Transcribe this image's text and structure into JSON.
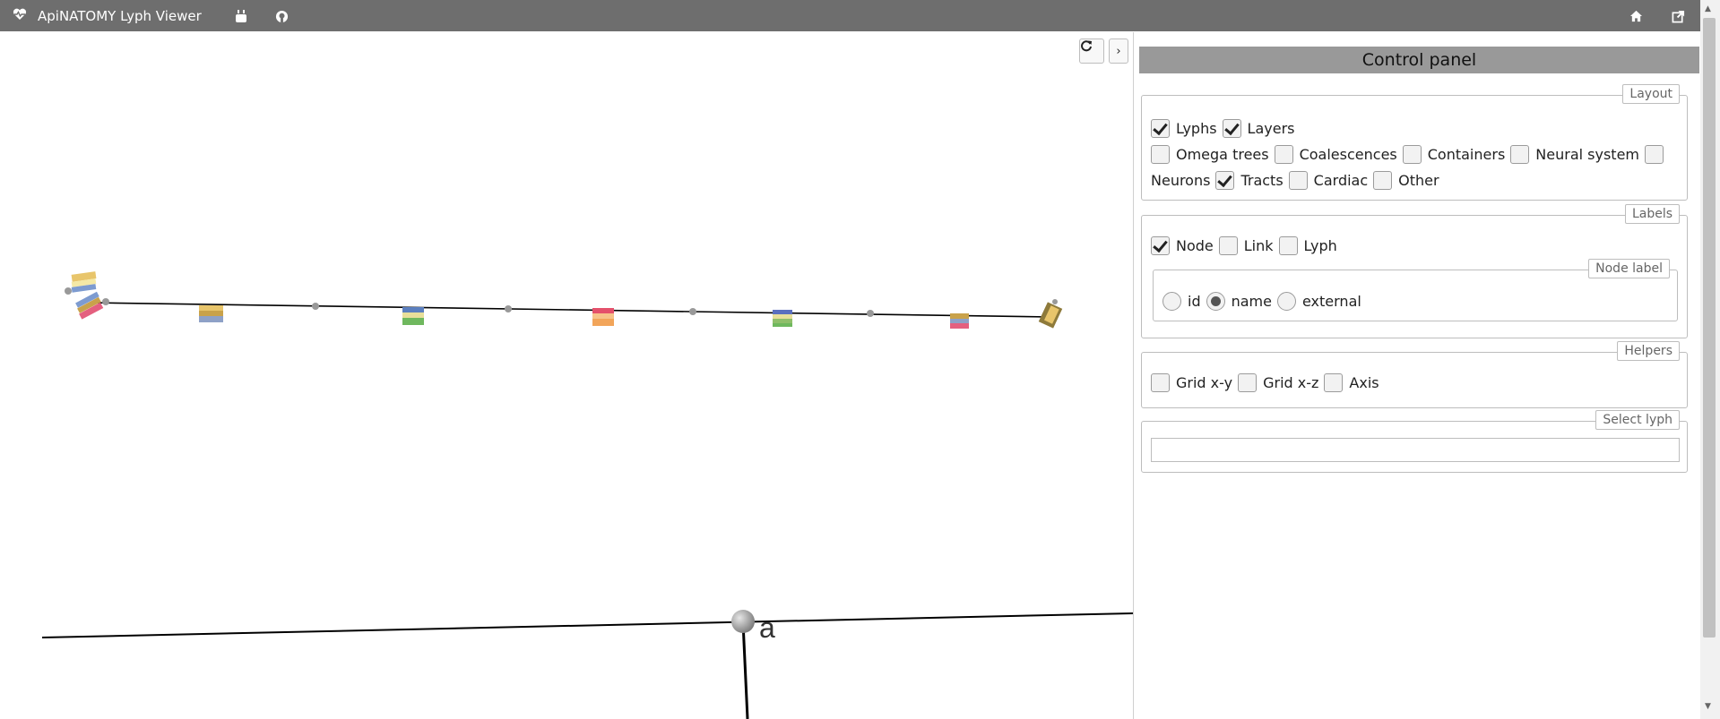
{
  "app": {
    "title": "ApiNATOMY Lyph Viewer",
    "icons": [
      "heart-logo-icon",
      "youtube-icon",
      "github-icon",
      "home-icon",
      "external-link-icon"
    ]
  },
  "sidetools": [
    "open-folder-icon",
    "edit-icon"
  ],
  "viewer": {
    "node_label": "a",
    "buttons": [
      "refresh-icon",
      "chevron-right-icon"
    ],
    "lyph_colors": [
      "#e8c56b",
      "#f2a55a",
      "#7d9bd0",
      "#6fb85e",
      "#e4607f",
      "#9a9a9a"
    ]
  },
  "panel": {
    "title": "Control panel",
    "layout": {
      "legend": "Layout",
      "items": [
        {
          "label": "Lyphs",
          "checked": true
        },
        {
          "label": "Layers",
          "checked": true
        },
        {
          "label": "Omega trees",
          "checked": false
        },
        {
          "label": "Coalescences",
          "checked": false
        },
        {
          "label": "Containers",
          "checked": false
        },
        {
          "label": "Neural system",
          "checked": false
        },
        {
          "label": "Neurons",
          "checked": false
        },
        {
          "label": "Tracts",
          "checked": true
        },
        {
          "label": "Cardiac",
          "checked": false
        },
        {
          "label": "Other",
          "checked": false
        }
      ]
    },
    "labels": {
      "legend": "Labels",
      "items": [
        {
          "label": "Node",
          "checked": true
        },
        {
          "label": "Link",
          "checked": false
        },
        {
          "label": "Lyph",
          "checked": false
        }
      ],
      "node_label": {
        "legend": "Node label",
        "options": [
          "id",
          "name",
          "external"
        ],
        "selected": "name"
      }
    },
    "helpers": {
      "legend": "Helpers",
      "items": [
        {
          "label": "Grid x-y",
          "checked": false
        },
        {
          "label": "Grid x-z",
          "checked": false
        },
        {
          "label": "Axis",
          "checked": false
        }
      ]
    },
    "select_lyph": {
      "legend": "Select lyph",
      "value": ""
    }
  }
}
